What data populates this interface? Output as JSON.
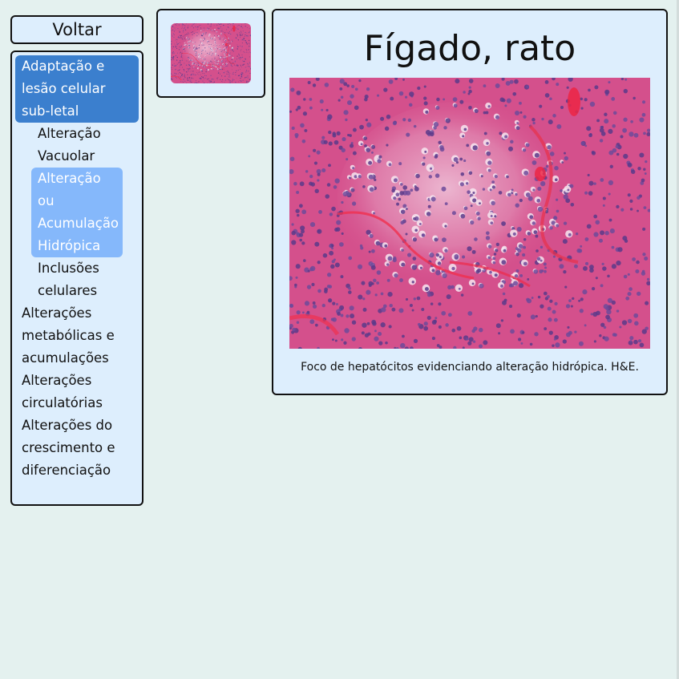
{
  "navigation": {
    "back_label": "Voltar"
  },
  "sidebar": {
    "items": [
      {
        "label": "Adaptação e lesão celular sub-letal",
        "state": "active-parent"
      },
      {
        "label": "Alteração Vacuolar",
        "state": "child"
      },
      {
        "label": "Alteração ou Acumulação Hidrópica",
        "state": "active-child"
      },
      {
        "label": "Inclusões celulares",
        "state": "child"
      },
      {
        "label": "Alterações metabólicas e acumulações",
        "state": "top"
      },
      {
        "label": "Alterações circulatórias",
        "state": "top"
      },
      {
        "label": "Alterações do crescimento e diferenciação",
        "state": "top"
      }
    ]
  },
  "main": {
    "title": "Fígado, rato",
    "caption": "Foco de hepatócitos evidenciando alteração hidrópica. H&E."
  },
  "colors": {
    "page_bg": "#e4f1ef",
    "panel_bg": "#ddeefd",
    "active_parent": "#3b7fce",
    "active_child": "#85b8fb",
    "tissue_pink": "#d9558f"
  }
}
